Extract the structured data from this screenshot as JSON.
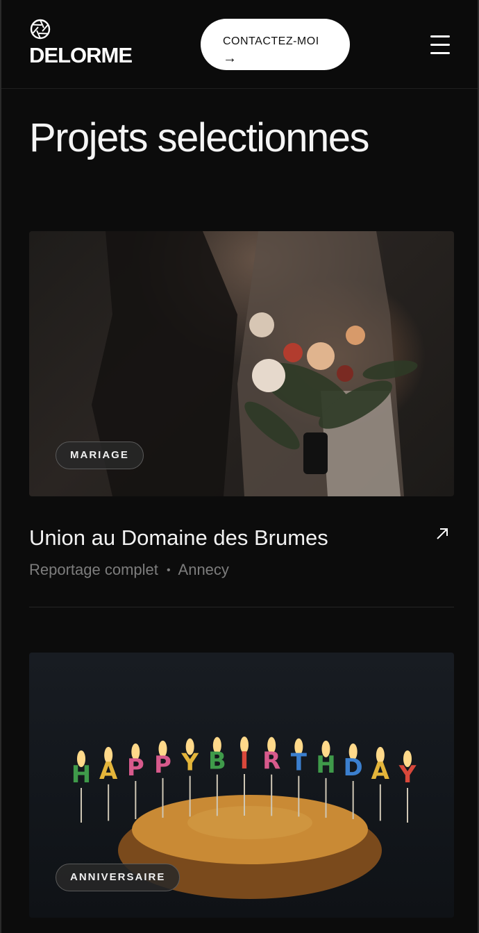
{
  "header": {
    "brand": "DELORME",
    "contact_label": "CONTACTEZ-MOI",
    "contact_arrow": "→",
    "logo_icon": "aperture-icon",
    "menu_icon": "hamburger-menu-icon"
  },
  "main": {
    "title": "Projets selectionnes",
    "projects": [
      {
        "tag": "MARIAGE",
        "title": "Union au Domaine des Brumes",
        "meta_type": "Reportage complet",
        "meta_separator": "•",
        "meta_location": "Annecy",
        "link_icon": "external-arrow-icon"
      },
      {
        "tag": "ANNIVERSAIRE",
        "cake_letters": [
          "H",
          "A",
          "P",
          "P",
          "Y",
          "B",
          "I",
          "R",
          "T",
          "H",
          "D",
          "A",
          "Y"
        ],
        "cake_colors": [
          "#3f9a4a",
          "#e4b53a",
          "#d75a8c",
          "#d75a8c",
          "#e4b53a",
          "#3f9a4a",
          "#d9483b",
          "#d75a8c",
          "#3b7fce",
          "#3f9a4a",
          "#3b7fce",
          "#e4b53a",
          "#d9483b"
        ]
      }
    ]
  }
}
